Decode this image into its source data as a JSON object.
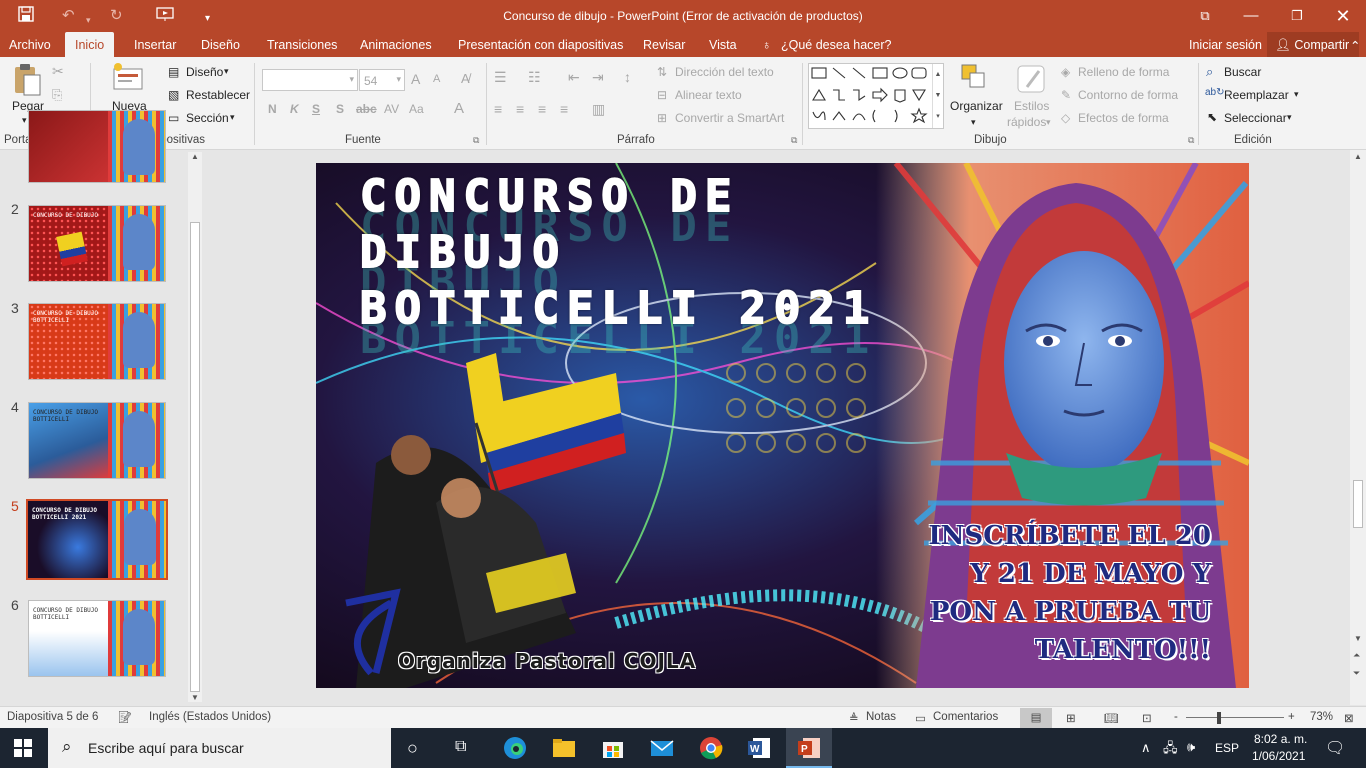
{
  "window": {
    "title": "Concurso de dibujo - PowerPoint (Error de activación de productos)"
  },
  "tabs": {
    "file": "Archivo",
    "home": "Inicio",
    "insert": "Insertar",
    "design": "Diseño",
    "transitions": "Transiciones",
    "animations": "Animaciones",
    "slideshow": "Presentación con diapositivas",
    "review": "Revisar",
    "view": "Vista",
    "tellme": "¿Qué desea hacer?",
    "signin": "Iniciar sesión",
    "share": "Compartir"
  },
  "ribbon": {
    "clipboard": {
      "paste": "Pegar",
      "group": "Portapapeles"
    },
    "slides": {
      "new_line1": "Nueva",
      "new_line2": "diapositiva",
      "layout": "Diseño",
      "reset": "Restablecer",
      "section": "Sección",
      "group": "Diapositivas"
    },
    "font": {
      "size": "54",
      "group": "Fuente",
      "bold": "N",
      "italic": "K",
      "underline": "S",
      "strike": "S",
      "grow": "A",
      "shrink": "A",
      "case": "Aa",
      "color": "A"
    },
    "paragraph": {
      "direction": "Dirección del texto",
      "align": "Alinear texto",
      "smartart": "Convertir a SmartArt",
      "group": "Párrafo"
    },
    "drawing": {
      "arrange": "Organizar",
      "quick_styles_1": "Estilos",
      "quick_styles_2": "rápidos",
      "fill": "Relleno de forma",
      "outline": "Contorno de forma",
      "effects": "Efectos de forma",
      "group": "Dibujo"
    },
    "editing": {
      "find": "Buscar",
      "replace": "Reemplazar",
      "select": "Seleccionar",
      "group": "Edición"
    }
  },
  "thumbnails": [
    {
      "num": "2",
      "text": "CONCURSO DE DIBUJO"
    },
    {
      "num": "3",
      "text": "CONCURSO DE DIBUJO BOTTICELLI"
    },
    {
      "num": "4",
      "text": "CONCURSO DE DIBUJO BOTTICELLI"
    },
    {
      "num": "5",
      "text": "CONCURSO DE DIBUJO BOTTICELLI 2021"
    },
    {
      "num": "6",
      "text": "CONCURSO DE DIBUJO BOTTICELLI"
    }
  ],
  "slide": {
    "title_line1": "CONCURSO DE",
    "title_line2": "DIBUJO",
    "title_line3": "BOTTICELLI 2021",
    "cta_line1": "INSCRÍBETE EL 20",
    "cta_line2": "Y 21 DE MAYO Y",
    "cta_line3": "PON A PRUEBA TU",
    "cta_line4": "TALENTO!!!",
    "organizer": "Organiza Pastoral COJLA"
  },
  "status": {
    "slide_info": "Diapositiva 5 de 6",
    "language": "Inglés (Estados Unidos)",
    "notes": "Notas",
    "comments": "Comentarios",
    "zoom": "73%",
    "zoom_minus": "-",
    "zoom_plus": "+"
  },
  "taskbar": {
    "search_placeholder": "Escribe aquí para buscar",
    "lang": "ESP",
    "time": "8:02 a. m.",
    "date": "1/06/2021"
  },
  "colors": {
    "accent": "#b7472a",
    "taskbar": "#1c2531"
  }
}
